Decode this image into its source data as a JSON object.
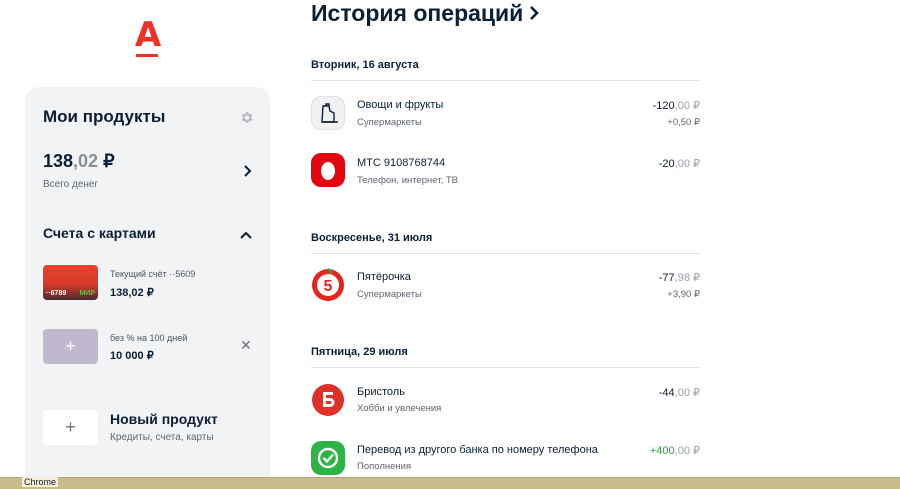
{
  "logo": {
    "letter": "А"
  },
  "sidebar": {
    "title": "Мои продукты",
    "total": {
      "integer": "138",
      "kop": ",02",
      "currency": " ₽",
      "caption": "Всего денег"
    },
    "accounts_section": {
      "title": "Счета с картами",
      "items": [
        {
          "name": "Текущий счёт ··5609",
          "balance": "138,02 ₽",
          "card_number": "··6789",
          "card_brand": "МИР"
        },
        {
          "name": "без % на 100 дней",
          "balance": "10 000 ₽"
        }
      ]
    },
    "new_product": {
      "title": "Новый продукт",
      "subtitle": "Кредиты, счета, карты",
      "plus": "+"
    }
  },
  "history": {
    "title": "История операций",
    "days": [
      {
        "label": "Вторник, 16 августа",
        "operations": [
          {
            "name": "Овощи и фрукты",
            "category": "Супермаркеты",
            "amount_int": "-120",
            "amount_kop": ",00 ₽",
            "cashback": "+0,50 ₽",
            "icon": "vegetables-icon"
          },
          {
            "name": "МТС 9108768744",
            "category": "Телефон, интернет, ТВ",
            "amount_int": "-20",
            "amount_kop": ",00 ₽",
            "cashback": "",
            "icon": "mts-logo-icon"
          }
        ]
      },
      {
        "label": "Воскресенье, 31 июля",
        "operations": [
          {
            "name": "Пятёрочка",
            "category": "Супермаркеты",
            "amount_int": "-77",
            "amount_kop": ",98 ₽",
            "cashback": "+3,90 ₽",
            "icon": "pyaterochka-logo-icon"
          }
        ]
      },
      {
        "label": "Пятница, 29 июля",
        "operations": [
          {
            "name": "Бристоль",
            "category": "Хобби и увлечения",
            "amount_int": "-44",
            "amount_kop": ",00 ₽",
            "cashback": "",
            "icon": "bristol-logo-icon"
          },
          {
            "name": "Перевод из другого банка по номеру телефона",
            "category": "Пополнения",
            "amount_int": "+400",
            "amount_kop": ",00 ₽",
            "cashback": "",
            "icon": "sbp-check-icon"
          }
        ]
      }
    ]
  },
  "taskbar": {
    "label": "Chrome"
  },
  "colors": {
    "brand_red": "#ef3124",
    "positive_green": "#22a647",
    "panel_bg": "#f2f3f5"
  }
}
